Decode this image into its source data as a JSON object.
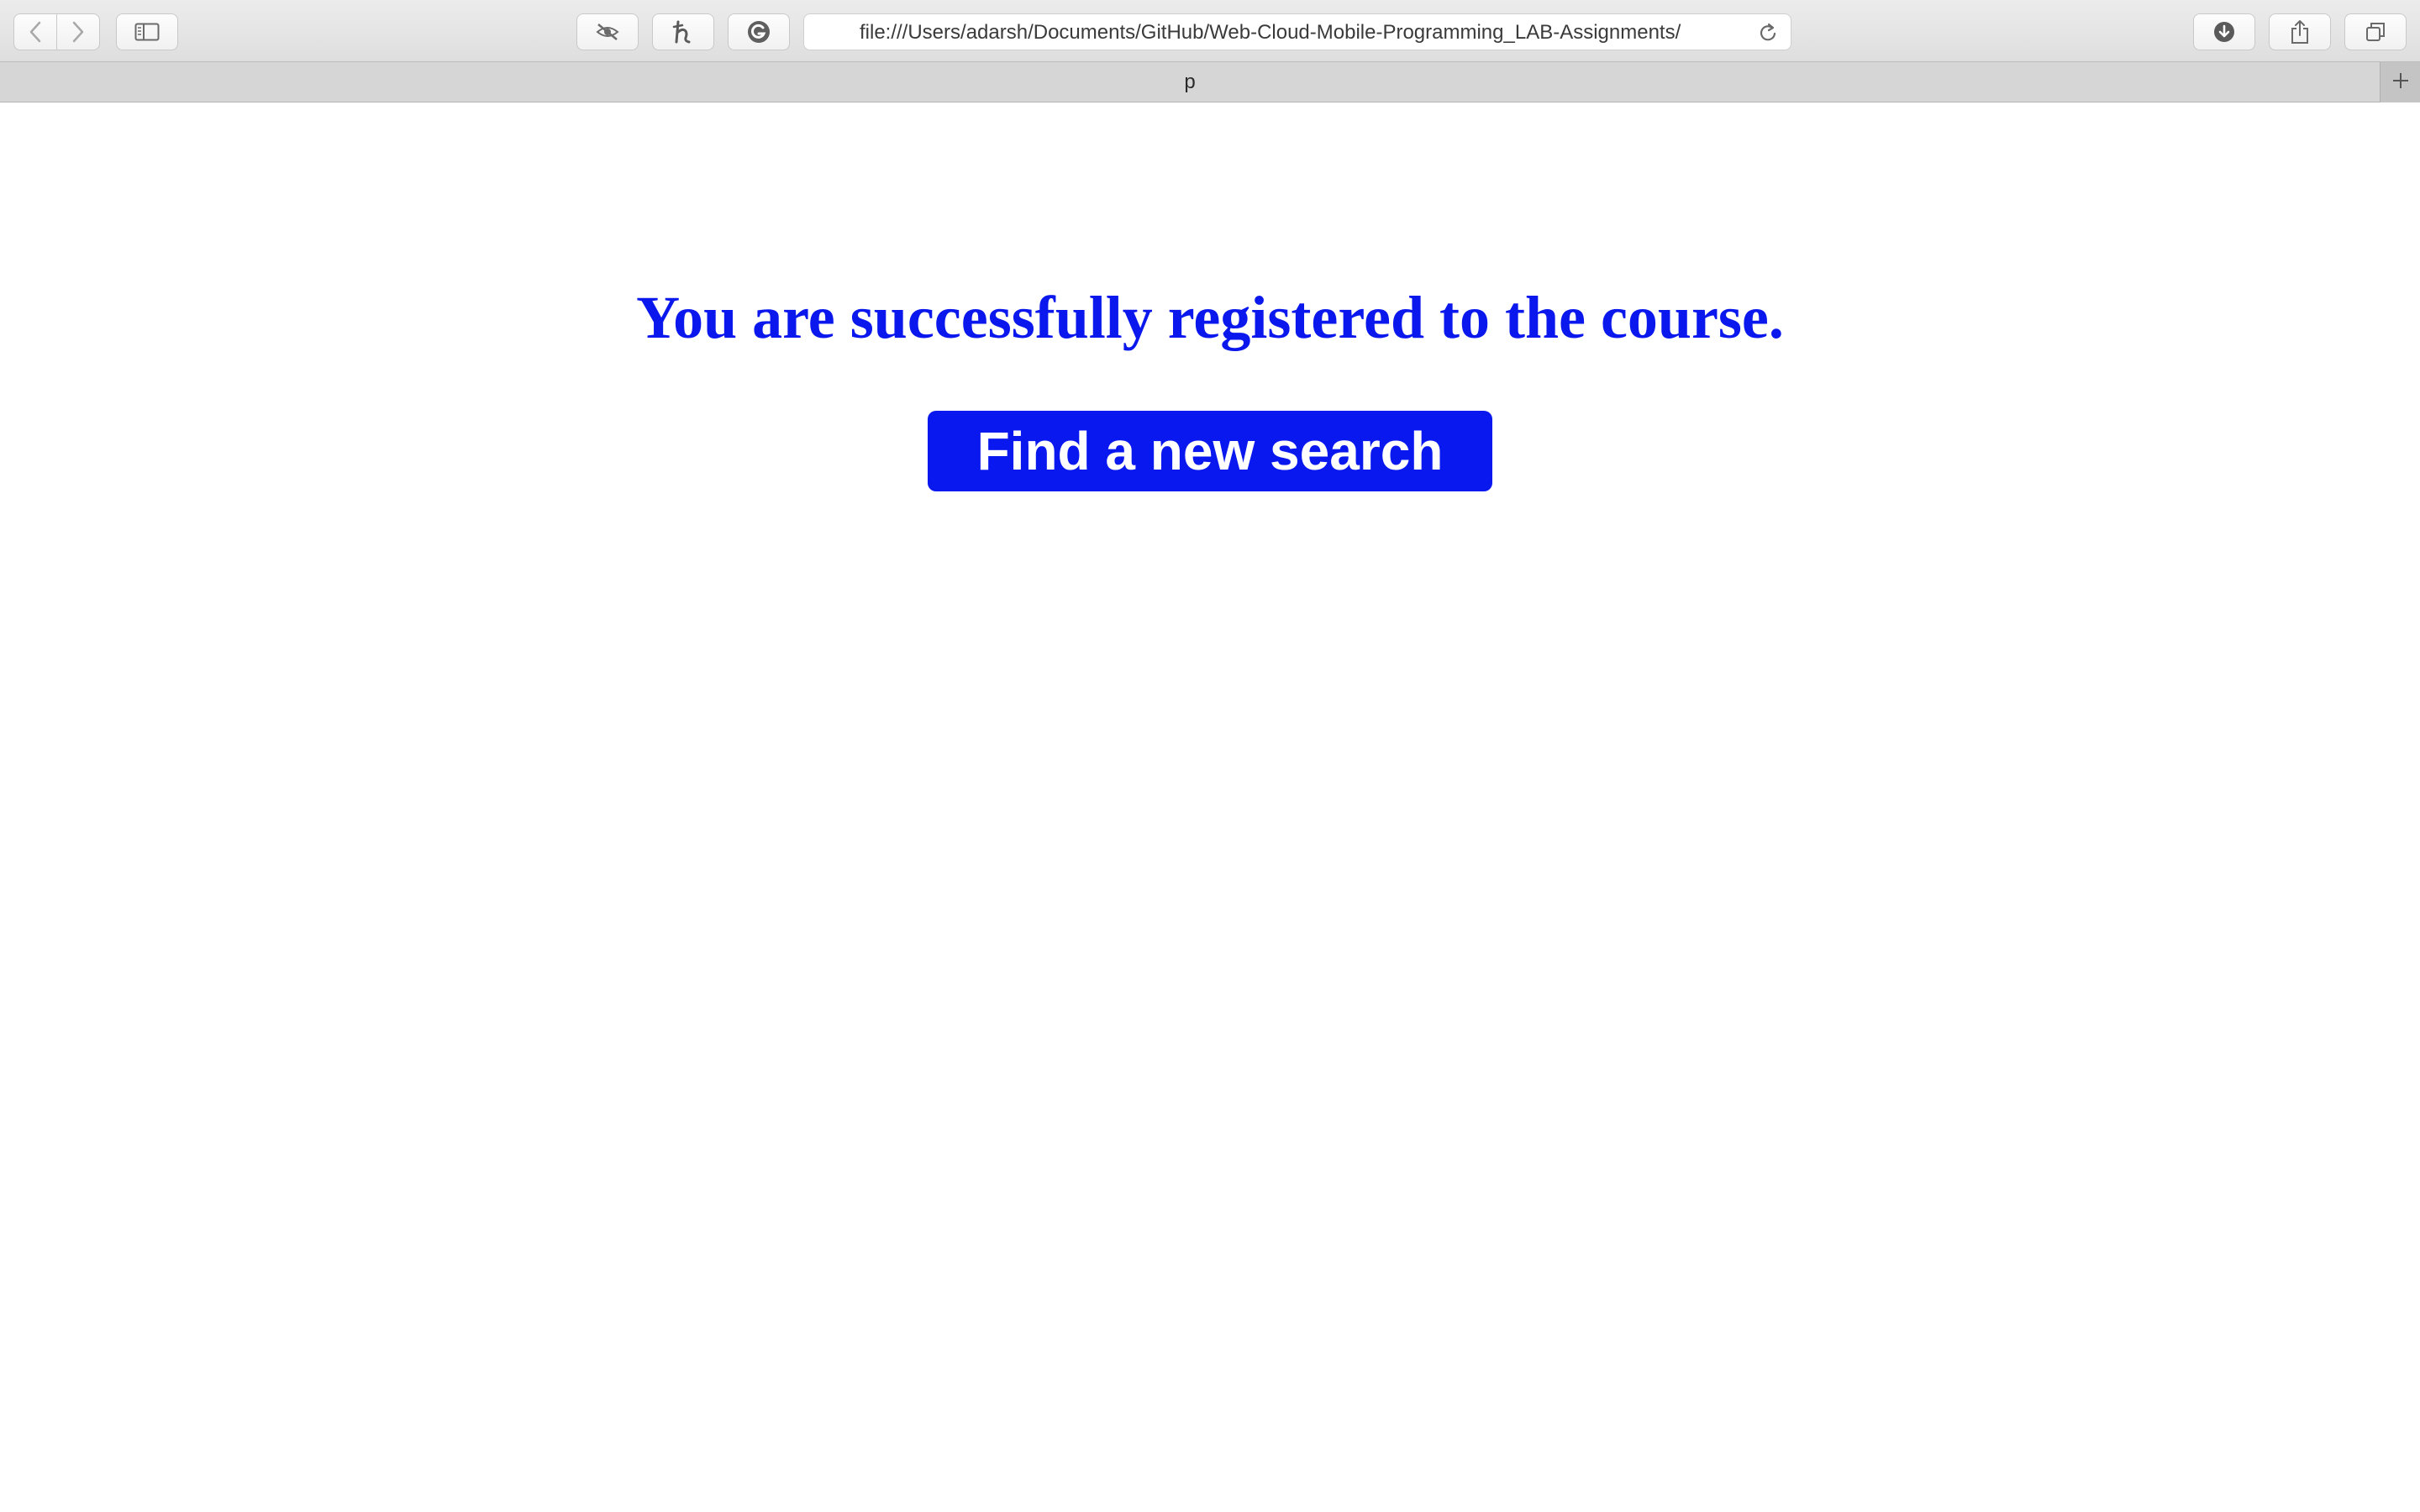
{
  "browser": {
    "address_url": "file:///Users/adarsh/Documents/GitHub/Web-Cloud-Mobile-Programming_LAB-Assignments/",
    "tab_title": "p",
    "icons": {
      "back": "chevron-left-icon",
      "forward": "chevron-right-icon",
      "sidebar": "sidebar-icon",
      "extension_1": "strikethrough-eye-icon",
      "extension_2": "honey-h-icon",
      "extension_3": "grammarly-g-icon",
      "reload": "reload-icon",
      "downloads": "download-icon",
      "share": "share-icon",
      "tabs": "tabs-overview-icon",
      "new_tab": "plus-icon"
    }
  },
  "page": {
    "message": "You are successfully registered to the course.",
    "button_label": "Find a new search"
  },
  "colors": {
    "accent": "#0a18ee",
    "button_background": "#0a18f0",
    "button_text": "#ffffff"
  }
}
